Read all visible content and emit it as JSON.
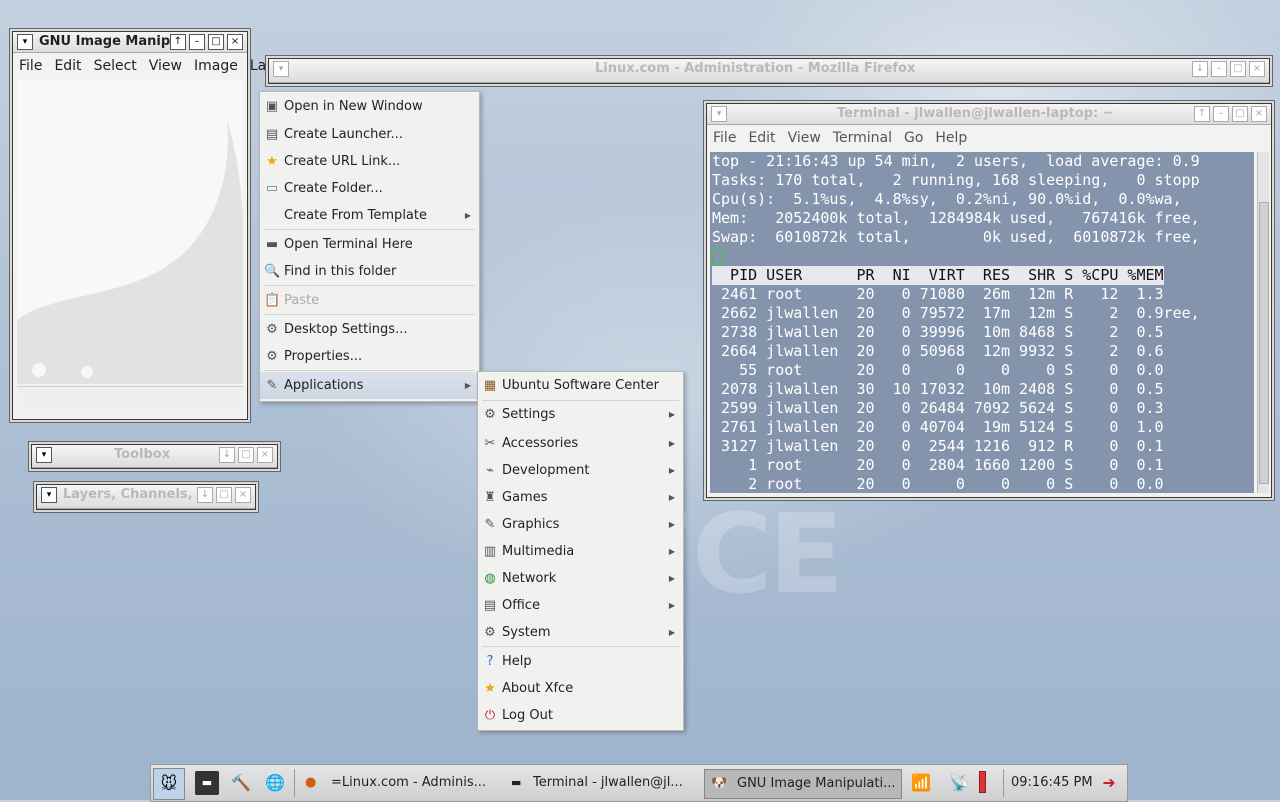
{
  "gimp": {
    "title": "GNU Image Manipu",
    "menu": [
      "File",
      "Edit",
      "Select",
      "View",
      "Image",
      "La"
    ]
  },
  "firefox": {
    "title": "Linux.com - Administration - Mozilla Firefox"
  },
  "toolbox": {
    "title": "Toolbox"
  },
  "layers": {
    "title": "Layers, Channels, P"
  },
  "terminal": {
    "title": "Terminal - jlwallen@jlwallen-laptop: ~",
    "menu": [
      "File",
      "Edit",
      "View",
      "Terminal",
      "Go",
      "Help"
    ],
    "lines": [
      "top - 21:16:43 up 54 min,  2 users,  load average: 0.9",
      "Tasks: 170 total,   2 running, 168 sleeping,   0 stopp",
      "Cpu(s):  5.1%us,  4.8%sy,  0.2%ni, 90.0%id,  0.0%wa,",
      "Mem:   2052400k total,  1284984k used,   767416k free,",
      "Swap:  6010872k total,        0k used,  6010872k free,",
      ""
    ],
    "header": "  PID USER      PR  NI  VIRT  RES  SHR S %CPU %MEM",
    "rows": [
      " 2461 root      20   0 71080  26m  12m R   12  1.3",
      " 2662 jlwallen  20   0 79572  17m  12m S    2  0.9ree,",
      " 2738 jlwallen  20   0 39996  10m 8468 S    2  0.5",
      " 2664 jlwallen  20   0 50968  12m 9932 S    2  0.6",
      "   55 root      20   0     0    0    0 S    0  0.0",
      " 2078 jlwallen  30  10 17032  10m 2408 S    0  0.5",
      " 2599 jlwallen  20   0 26484 7092 5624 S    0  0.3",
      " 2761 jlwallen  20   0 40704  19m 5124 S    0  1.0",
      " 3127 jlwallen  20   0  2544 1216  912 R    0  0.1",
      "    1 root      20   0  2804 1660 1200 S    0  0.1",
      "    2 root      20   0     0    0    0 S    0  0.0"
    ]
  },
  "desktop_menu": [
    {
      "label": "Open in New Window",
      "icon": "window-icon"
    },
    {
      "label": "Create Launcher...",
      "icon": "launcher-icon"
    },
    {
      "label": "Create URL Link...",
      "icon": "star-icon"
    },
    {
      "label": "Create Folder...",
      "icon": "folder-icon"
    },
    {
      "label": "Create From Template",
      "icon": "",
      "submenu": true
    },
    {
      "label": "Open Terminal Here",
      "icon": "terminal-icon"
    },
    {
      "label": "Find in this folder",
      "icon": "search-icon"
    },
    {
      "label": "Paste",
      "icon": "paste-icon",
      "disabled": true
    },
    {
      "label": "Desktop Settings...",
      "icon": "settings-icon"
    },
    {
      "label": "Properties...",
      "icon": "properties-icon"
    },
    {
      "label": "Applications",
      "icon": "applications-icon",
      "submenu": true,
      "highlighted": true
    }
  ],
  "apps_menu": [
    {
      "label": "Ubuntu Software Center",
      "icon": "software-center-icon"
    },
    {
      "label": "Settings",
      "icon": "settings-icon",
      "submenu": true
    },
    {
      "label": "Accessories",
      "icon": "accessories-icon",
      "submenu": true
    },
    {
      "label": "Development",
      "icon": "development-icon",
      "submenu": true
    },
    {
      "label": "Games",
      "icon": "games-icon",
      "submenu": true
    },
    {
      "label": "Graphics",
      "icon": "graphics-icon",
      "submenu": true
    },
    {
      "label": "Multimedia",
      "icon": "multimedia-icon",
      "submenu": true
    },
    {
      "label": "Network",
      "icon": "network-icon",
      "submenu": true
    },
    {
      "label": "Office",
      "icon": "office-icon",
      "submenu": true
    },
    {
      "label": "System",
      "icon": "system-icon",
      "submenu": true
    },
    {
      "label": "Help",
      "icon": "help-icon"
    },
    {
      "label": "About Xfce",
      "icon": "about-icon"
    },
    {
      "label": "Log Out",
      "icon": "logout-icon"
    }
  ],
  "panel": {
    "tasks": [
      {
        "label": "=Linux.com - Adminis...",
        "icon": "firefox-icon"
      },
      {
        "label": "Terminal - jlwallen@jl...",
        "icon": "terminal-icon"
      },
      {
        "label": "GNU Image Manipulati...",
        "icon": "gimp-icon",
        "active": true
      }
    ],
    "clock": "09:16:45 PM"
  },
  "colors": {
    "terminal_bg": "#8494ad",
    "menu_highlight": "#cdd6e2",
    "desktop": "#b6c6d8"
  }
}
